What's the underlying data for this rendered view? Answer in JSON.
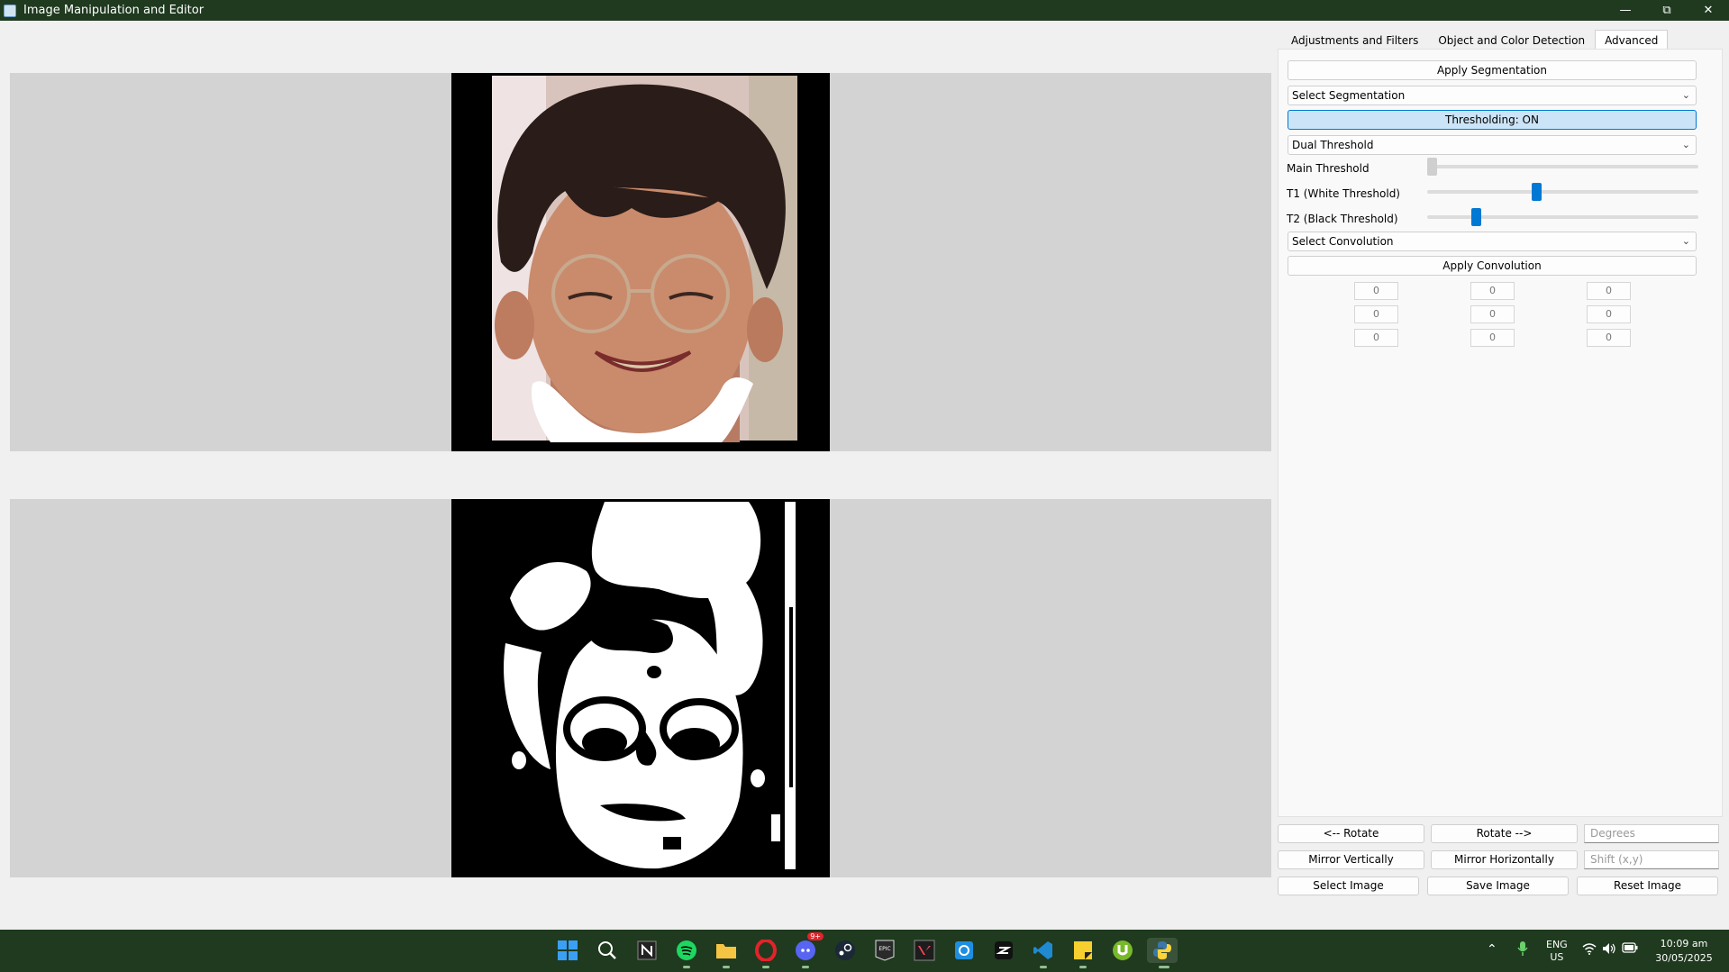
{
  "window": {
    "title": "Image Manipulation and Editor"
  },
  "tabs": [
    {
      "label": "Adjustments and Filters"
    },
    {
      "label": "Object and Color Detection"
    },
    {
      "label": "Advanced"
    }
  ],
  "advanced": {
    "apply_segmentation": "Apply Segmentation",
    "segmentation_select": "Select Segmentation",
    "thresholding_toggle": "Thresholding: ON",
    "threshold_mode": "Dual Threshold",
    "sliders": [
      {
        "label": "Main Threshold",
        "value": 0.0,
        "enabled": false
      },
      {
        "label": "T1 (White Threshold)",
        "value": 0.4,
        "enabled": true
      },
      {
        "label": "T2 (Black Threshold)",
        "value": 0.17,
        "enabled": true
      }
    ],
    "convolution_select": "Select Convolution",
    "apply_convolution": "Apply Convolution",
    "kernel": [
      [
        "0",
        "0",
        "0"
      ],
      [
        "0",
        "0",
        "0"
      ],
      [
        "0",
        "0",
        "0"
      ]
    ]
  },
  "bottom": {
    "rotate_left": "<-- Rotate",
    "rotate_right": "Rotate -->",
    "degrees_placeholder": "Degrees",
    "mirror_v": "Mirror Vertically",
    "mirror_h": "Mirror Horizontally",
    "shift_placeholder": "Shift (x,y)",
    "select_image": "Select Image",
    "save_image": "Save Image",
    "reset_image": "Reset Image"
  },
  "taskbar": {
    "language": "ENG",
    "region": "US",
    "time": "10:09 am",
    "date": "30/05/2025",
    "discord_badge": "9+",
    "icons": [
      "windows-start-icon",
      "search-icon",
      "notion-icon",
      "spotify-icon",
      "file-explorer-icon",
      "opera-icon",
      "discord-icon",
      "steam-icon",
      "epic-games-icon",
      "valorant-icon",
      "outlook-icon",
      "capcut-icon",
      "vscode-icon",
      "sticky-notes-icon",
      "utorrent-icon",
      "python-icon"
    ]
  },
  "colors": {
    "titlebar": "#1f3a1f",
    "accent": "#0078d4",
    "panel": "#d3d3d3"
  }
}
